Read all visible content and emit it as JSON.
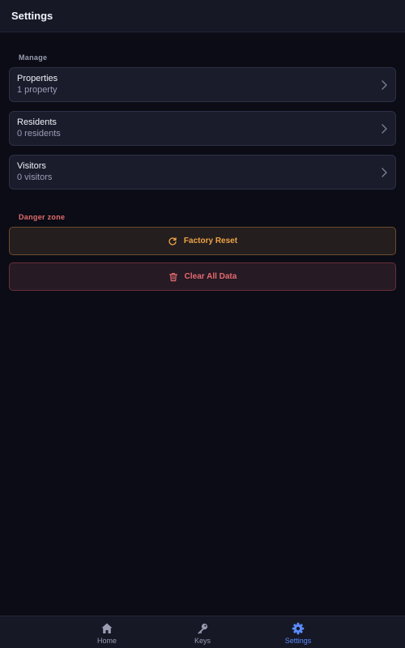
{
  "header": {
    "title": "Settings"
  },
  "manage": {
    "label": "Manage",
    "items": [
      {
        "title": "Properties",
        "subtitle": "1 property"
      },
      {
        "title": "Residents",
        "subtitle": "0 residents"
      },
      {
        "title": "Visitors",
        "subtitle": "0 visitors"
      }
    ]
  },
  "danger": {
    "label": "Danger zone",
    "factory_reset": "Factory Reset",
    "clear_all": "Clear All Data"
  },
  "tabs": [
    {
      "label": "Home",
      "icon": "home-icon"
    },
    {
      "label": "Keys",
      "icon": "key-icon"
    },
    {
      "label": "Settings",
      "icon": "gear-icon",
      "active": true
    }
  ],
  "colors": {
    "background": "#0b0c15",
    "card": "#1a1c2c",
    "accent": "#5b8cff",
    "warning": "#f0a447",
    "danger": "#e46a6e"
  }
}
